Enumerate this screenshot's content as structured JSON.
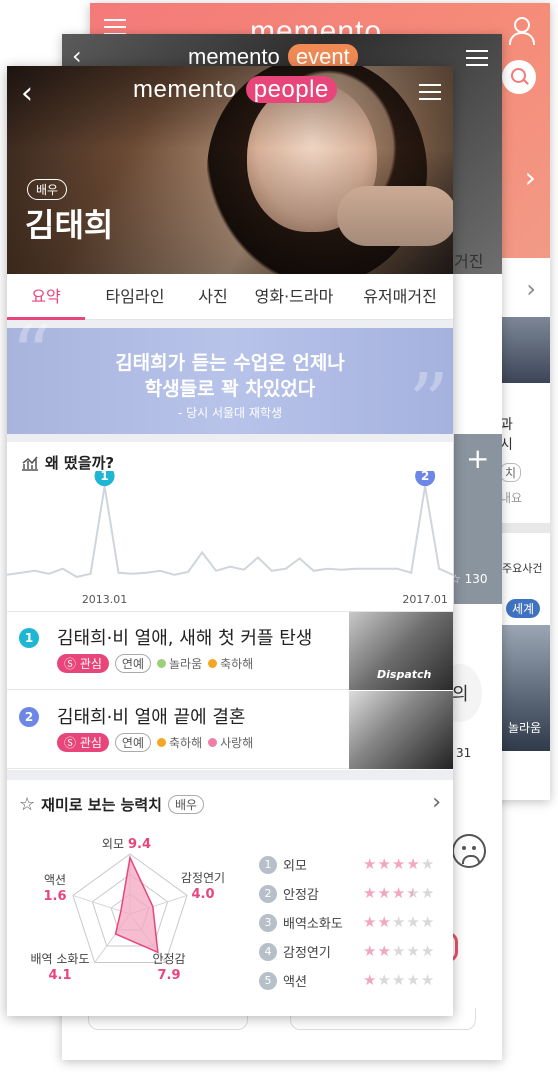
{
  "back_card": {
    "logo": "memento",
    "tab_right": "",
    "article_lines": [
      "과",
      "시"
    ],
    "article_reaction": "내요",
    "major_events_label": "주요사건",
    "world_tag": "세계",
    "reaction_label": "놀라움"
  },
  "mid_card": {
    "logo": "memento",
    "logo_tag": "event",
    "tab_right": "거진",
    "like_count": "130",
    "circle_label": "의",
    "number": "31"
  },
  "header": {
    "logo": "memento",
    "logo_tag": "people",
    "badge": "배우",
    "name": "김태희"
  },
  "tabs": [
    "요약",
    "타임라인",
    "사진",
    "영화·드라마",
    "유저매거진"
  ],
  "quote": {
    "line1": "김태희가 듣는 수업은 언제나",
    "line2": "학생들로 꽉 차있었다",
    "source": "- 당시 서울대 재학생"
  },
  "trend": {
    "title": "왜 떴을까?",
    "x_labels": [
      "2013.01",
      "2017.01"
    ],
    "markers": [
      "1",
      "2"
    ],
    "colors": {
      "marker1": "#1fb6d4",
      "marker2": "#6d87e6",
      "line": "#cfd5db"
    },
    "values": [
      8,
      10,
      12,
      9,
      14,
      6,
      9,
      95,
      10,
      9,
      10,
      12,
      8,
      11,
      30,
      12,
      16,
      13,
      25,
      12,
      14,
      24,
      12,
      14,
      13,
      14,
      14,
      14,
      14,
      10,
      95,
      14,
      8
    ]
  },
  "events": [
    {
      "num": "1",
      "title": "김태희·비 열애, 새해 첫 커플 탄생",
      "score_label": "관심",
      "category": "연예",
      "reactions": [
        {
          "label": "놀라움",
          "color": "#9bd07a"
        },
        {
          "label": "축하해",
          "color": "#f6a623"
        }
      ],
      "thumb_text": "Dispatch"
    },
    {
      "num": "2",
      "title": "김태희·비 열애 끝에 결혼",
      "score_label": "관심",
      "category": "연예",
      "reactions": [
        {
          "label": "축하해",
          "color": "#f6a623"
        },
        {
          "label": "사랑해",
          "color": "#f07fa8"
        }
      ]
    }
  ],
  "ability": {
    "title": "재미로 보는 능력치",
    "badge": "배우",
    "radar": [
      {
        "label": "외모",
        "value": "9.4"
      },
      {
        "label": "감정연기",
        "value": "4.0"
      },
      {
        "label": "안정감",
        "value": "7.9"
      },
      {
        "label": "배역 소화도",
        "value": "4.1"
      },
      {
        "label": "액션",
        "value": "1.6"
      }
    ],
    "stats": [
      {
        "n": "1",
        "label": "외모",
        "stars": 4
      },
      {
        "n": "2",
        "label": "안정감",
        "stars": 3.5
      },
      {
        "n": "3",
        "label": "배역소화도",
        "stars": 2
      },
      {
        "n": "4",
        "label": "감정연기",
        "stars": 2
      },
      {
        "n": "5",
        "label": "액션",
        "stars": 1
      }
    ],
    "colors": {
      "accent": "#e8467a",
      "fill": "#f2a7bf"
    }
  }
}
